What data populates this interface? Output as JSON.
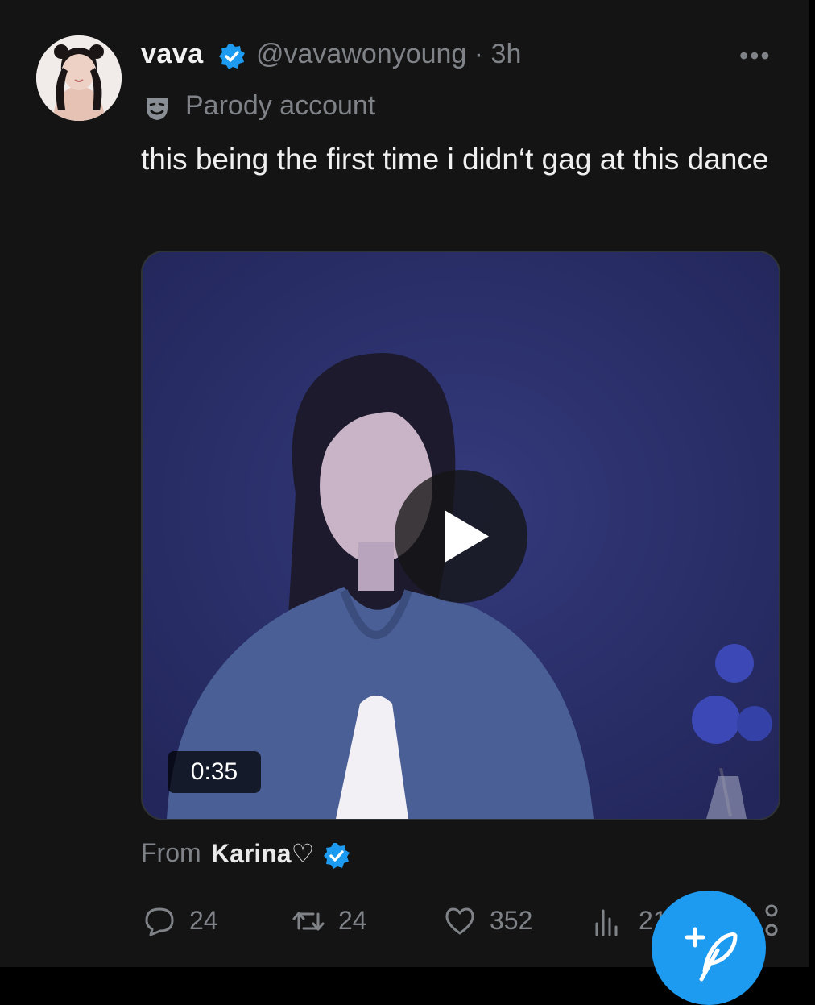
{
  "post": {
    "display_name": "vava",
    "handle_time": "@vavawonyoung · 3h",
    "more_label": "•••",
    "parody_label": "Parody account",
    "text": "this being the first time i didn‘t gag at this dance",
    "media": {
      "duration": "0:35"
    },
    "source": {
      "from_label": "From",
      "name": "Karina♡"
    },
    "actions": {
      "replies": "24",
      "reposts": "24",
      "likes": "352",
      "views": "21"
    }
  },
  "icons": {
    "verified": "verified-badge-icon",
    "parody": "theater-mask-icon",
    "reply": "reply-icon",
    "repost": "repost-icon",
    "like": "heart-icon",
    "views": "views-icon",
    "compose": "compose-feather-icon",
    "play": "play-icon"
  },
  "colors": {
    "accent": "#1d9bf0",
    "background": "#141414",
    "muted": "#7f8388",
    "media_background": "#2a2f6a"
  }
}
